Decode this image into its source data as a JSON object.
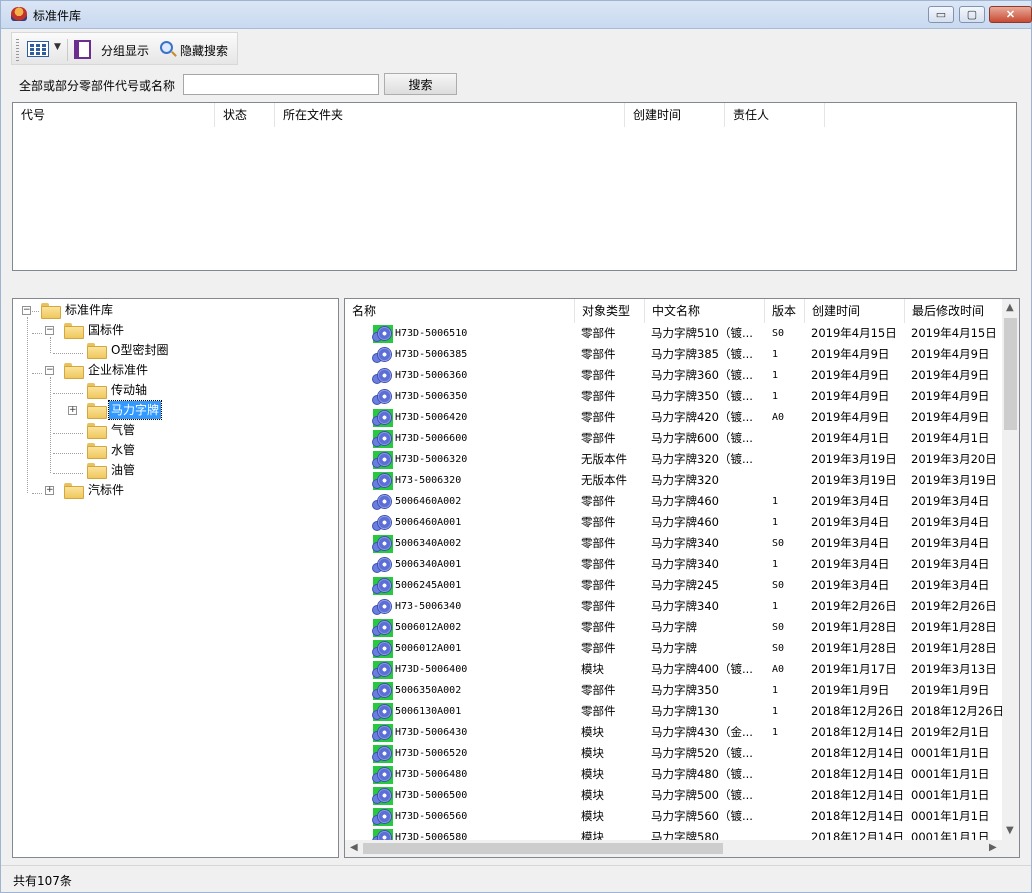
{
  "window": {
    "title": "标准件库",
    "icon": "app-logo-icon",
    "controls": {
      "minimize": "▭",
      "maximize": "▢",
      "close": "✕"
    }
  },
  "toolbar": {
    "view_icon": "grid-view-icon",
    "group_label": "分组显示",
    "hide_search_label": "隐藏搜索"
  },
  "search": {
    "label": "全部或部分零部件代号或名称",
    "value": "",
    "placeholder": "",
    "button": "搜索"
  },
  "results": {
    "columns": [
      "代号",
      "状态",
      "所在文件夹",
      "创建时间",
      "责任人"
    ]
  },
  "tree": {
    "items": [
      {
        "label": "标准件库",
        "expander": "−"
      },
      {
        "label": "国标件",
        "expander": "−"
      },
      {
        "label": "O型密封圈",
        "expander": ""
      },
      {
        "label": "企业标准件",
        "expander": "−"
      },
      {
        "label": "传动轴",
        "expander": ""
      },
      {
        "label": "马力字牌",
        "expander": "+"
      },
      {
        "label": "气管",
        "expander": ""
      },
      {
        "label": "水管",
        "expander": ""
      },
      {
        "label": "油管",
        "expander": ""
      },
      {
        "label": "汽标件",
        "expander": "+"
      }
    ],
    "selected": "马力字牌"
  },
  "grid": {
    "columns": [
      "名称",
      "对象类型",
      "中文名称",
      "版本",
      "创建时间",
      "最后修改时间"
    ],
    "rows": [
      {
        "name": "H73D-5006510",
        "type": "零部件",
        "cn": "马力字牌510（镀...",
        "ver": "S0",
        "created": "2019年4月15日",
        "modified": "2019年4月15日",
        "icon": "green"
      },
      {
        "name": "H73D-5006385",
        "type": "零部件",
        "cn": "马力字牌385（镀...",
        "ver": "1",
        "created": "2019年4月9日",
        "modified": "2019年4月9日",
        "icon": "plain"
      },
      {
        "name": "H73D-5006360",
        "type": "零部件",
        "cn": "马力字牌360（镀...",
        "ver": "1",
        "created": "2019年4月9日",
        "modified": "2019年4月9日",
        "icon": "plain"
      },
      {
        "name": "H73D-5006350",
        "type": "零部件",
        "cn": "马力字牌350（镀...",
        "ver": "1",
        "created": "2019年4月9日",
        "modified": "2019年4月9日",
        "icon": "plain"
      },
      {
        "name": "H73D-5006420",
        "type": "零部件",
        "cn": "马力字牌420（镀...",
        "ver": "A0",
        "created": "2019年4月9日",
        "modified": "2019年4月9日",
        "icon": "green"
      },
      {
        "name": "H73D-5006600",
        "type": "零部件",
        "cn": "马力字牌600（镀...",
        "ver": "",
        "created": "2019年4月1日",
        "modified": "2019年4月1日",
        "icon": "green"
      },
      {
        "name": "H73D-5006320",
        "type": "无版本件",
        "cn": "马力字牌320（镀...",
        "ver": "",
        "created": "2019年3月19日",
        "modified": "2019年3月20日",
        "icon": "green"
      },
      {
        "name": "H73-5006320",
        "type": "无版本件",
        "cn": "马力字牌320",
        "ver": "",
        "created": "2019年3月19日",
        "modified": "2019年3月19日",
        "icon": "green"
      },
      {
        "name": "5006460A002",
        "type": "零部件",
        "cn": "马力字牌460",
        "ver": "1",
        "created": "2019年3月4日",
        "modified": "2019年3月4日",
        "icon": "plain"
      },
      {
        "name": "5006460A001",
        "type": "零部件",
        "cn": "马力字牌460",
        "ver": "1",
        "created": "2019年3月4日",
        "modified": "2019年3月4日",
        "icon": "plain"
      },
      {
        "name": "5006340A002",
        "type": "零部件",
        "cn": "马力字牌340",
        "ver": "S0",
        "created": "2019年3月4日",
        "modified": "2019年3月4日",
        "icon": "green"
      },
      {
        "name": "5006340A001",
        "type": "零部件",
        "cn": "马力字牌340",
        "ver": "1",
        "created": "2019年3月4日",
        "modified": "2019年3月4日",
        "icon": "plain"
      },
      {
        "name": "5006245A001",
        "type": "零部件",
        "cn": "马力字牌245",
        "ver": "S0",
        "created": "2019年3月4日",
        "modified": "2019年3月4日",
        "icon": "green"
      },
      {
        "name": "H73-5006340",
        "type": "零部件",
        "cn": "马力字牌340",
        "ver": "1",
        "created": "2019年2月26日",
        "modified": "2019年2月26日",
        "icon": "plain"
      },
      {
        "name": "5006012A002",
        "type": "零部件",
        "cn": "马力字牌",
        "ver": "S0",
        "created": "2019年1月28日",
        "modified": "2019年1月28日",
        "icon": "green"
      },
      {
        "name": "5006012A001",
        "type": "零部件",
        "cn": "马力字牌",
        "ver": "S0",
        "created": "2019年1月28日",
        "modified": "2019年1月28日",
        "icon": "green"
      },
      {
        "name": "H73D-5006400",
        "type": "模块",
        "cn": "马力字牌400（镀...",
        "ver": "A0",
        "created": "2019年1月17日",
        "modified": "2019年3月13日",
        "icon": "green"
      },
      {
        "name": "5006350A002",
        "type": "零部件",
        "cn": "马力字牌350",
        "ver": "1",
        "created": "2019年1月9日",
        "modified": "2019年1月9日",
        "icon": "green"
      },
      {
        "name": "5006130A001",
        "type": "零部件",
        "cn": "马力字牌130",
        "ver": "1",
        "created": "2018年12月26日",
        "modified": "2018年12月26日",
        "icon": "green"
      },
      {
        "name": "H73D-5006430",
        "type": "模块",
        "cn": "马力字牌430（金...",
        "ver": "1",
        "created": "2018年12月14日",
        "modified": "2019年2月1日",
        "icon": "green"
      },
      {
        "name": "H73D-5006520",
        "type": "模块",
        "cn": "马力字牌520（镀...",
        "ver": "",
        "created": "2018年12月14日",
        "modified": "0001年1月1日",
        "icon": "green"
      },
      {
        "name": "H73D-5006480",
        "type": "模块",
        "cn": "马力字牌480（镀...",
        "ver": "",
        "created": "2018年12月14日",
        "modified": "0001年1月1日",
        "icon": "green"
      },
      {
        "name": "H73D-5006500",
        "type": "模块",
        "cn": "马力字牌500（镀...",
        "ver": "",
        "created": "2018年12月14日",
        "modified": "0001年1月1日",
        "icon": "green"
      },
      {
        "name": "H73D-5006560",
        "type": "模块",
        "cn": "马力字牌560（镀...",
        "ver": "",
        "created": "2018年12月14日",
        "modified": "0001年1月1日",
        "icon": "green"
      },
      {
        "name": "H73D-5006580",
        "type": "模块",
        "cn": "马力字牌580",
        "ver": "",
        "created": "2018年12月14日",
        "modified": "0001年1月1日",
        "icon": "green"
      }
    ]
  },
  "status": {
    "text": "共有107条"
  },
  "colors": {
    "selection": "#3399ff",
    "status_green": "#27c93f",
    "title_gradient": "#dbe6f5"
  }
}
